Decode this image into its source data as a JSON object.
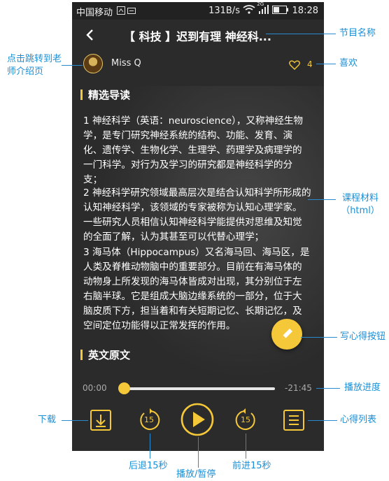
{
  "status": {
    "carrier": "中国移动",
    "speed": "131B/s",
    "network": "2G",
    "time": "18:28"
  },
  "header": {
    "title": "【 科技 】迟到有理 神经科..."
  },
  "author": {
    "name": "Miss Q",
    "likes": "4"
  },
  "sections": {
    "guide_title": "精选导读",
    "original_title": "英文原文"
  },
  "paragraphs": [
    "1 神经科学（英语：neuroscience），又称神经生物学，是专门研究神经系统的结构、功能、发育、演化、遗传学、生物化学、生理学、药理学及病理学的一门科学。对行为及学习的研究都是神经科学的分支；",
    "2 神经科学研究领域最高层次是结合认知科学所形成的认知神经科学，该领域的专家被称为认知心理学家。一些研究人员相信认知神经科学能提供对思维及知觉的全面了解，认为其甚至可以代替心理学；",
    "3 海马体（Hippocampus）又名海马回、海马区，是人类及脊椎动物脑中的重要部分。目前在有海马体的动物身上所发现的海马体皆成对出现，其分别位于左右脑半球。它是组成大脑边缘系统的一部分，位于大脑皮质下方，担当着和有关短期记忆、长期记忆，及空间定位功能得以正常发挥的作用。"
  ],
  "player": {
    "elapsed": "00:00",
    "remaining": "-21:45",
    "progress": 0,
    "rewind_seconds": "15",
    "forward_seconds": "15"
  },
  "annotations": {
    "program_name": "节目名称",
    "teacher_link": "点击跳转到老师介绍页",
    "like": "喜欢",
    "course_material": "课程材料（html）",
    "write_notes_button": "写心得按钮",
    "progress": "播放进度",
    "download": "下载",
    "notes_list": "心得列表",
    "rewind": "后退15秒",
    "play_pause": "播放/暂停",
    "forward": "前进15秒"
  },
  "colors": {
    "accent": "#f5c83a",
    "annotation": "#1b8fd6",
    "background": "#2b2b2b"
  },
  "icons": [
    "back-arrow-icon",
    "heart-icon",
    "pencil-icon",
    "download-icon",
    "rewind-15-icon",
    "play-icon",
    "forward-15-icon",
    "notes-list-icon"
  ]
}
